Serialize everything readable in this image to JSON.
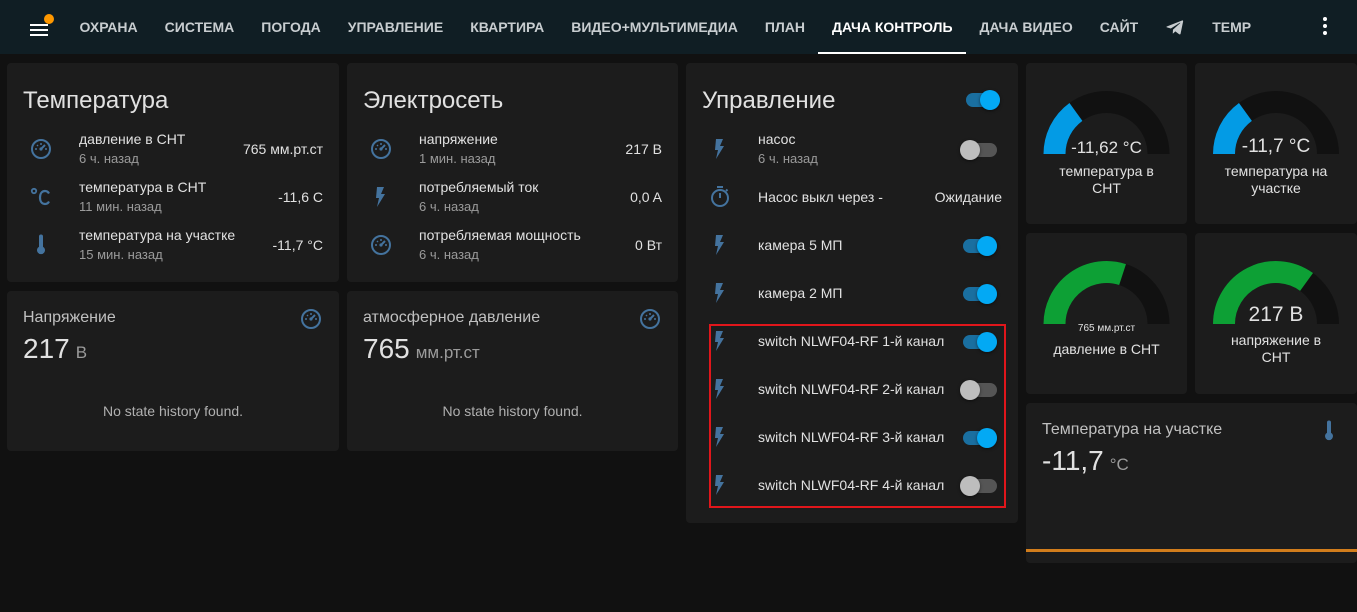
{
  "header": {
    "tabs": [
      {
        "label": "ОХРАНА"
      },
      {
        "label": "СИСТЕМА"
      },
      {
        "label": "ПОГОДА"
      },
      {
        "label": "УПРАВЛЕНИЕ"
      },
      {
        "label": "КВАРТИРА"
      },
      {
        "label": "ВИДЕО+МУЛЬТИМЕДИА"
      },
      {
        "label": "ПЛАН"
      },
      {
        "label": "ДАЧА КОНТРОЛЬ"
      },
      {
        "label": "ДАЧА ВИДЕО"
      },
      {
        "label": "САЙТ"
      },
      {
        "label": "",
        "icon": "telegram-icon"
      },
      {
        "label": "TEMP"
      }
    ],
    "active_tab": "ДАЧА КОНТРОЛЬ"
  },
  "temperature_card": {
    "title": "Температура",
    "rows": [
      {
        "name": "давление в СНТ",
        "sub": "6 ч. назад",
        "value": "765 мм.рт.ст",
        "icon": "gauge-icon"
      },
      {
        "name": "температура в СНТ",
        "sub": "11 мин. назад",
        "value": "-11,6 C",
        "icon": "celsius-icon"
      },
      {
        "name": "температура на участке",
        "sub": "15 мин. назад",
        "value": "-11,7 °C",
        "icon": "thermometer-icon"
      }
    ]
  },
  "power_card": {
    "title": "Электросеть",
    "rows": [
      {
        "name": "напряжение",
        "sub": "1 мин. назад",
        "value": "217 В",
        "icon": "gauge-icon"
      },
      {
        "name": "потребляемый ток",
        "sub": "6 ч. назад",
        "value": "0,0 A",
        "icon": "flash-icon"
      },
      {
        "name": "потребляемая мощность",
        "sub": "6 ч. назад",
        "value": "0 Вт",
        "icon": "gauge-icon"
      }
    ]
  },
  "control_card": {
    "title": "Управление",
    "master_toggle": true,
    "rows": [
      {
        "name": "насос",
        "sub": "6 ч. назад",
        "type": "toggle",
        "on": false,
        "icon": "flash-icon"
      },
      {
        "name": "Насос выкл через -",
        "type": "text",
        "value": "Ожидание",
        "icon": "timer-icon"
      },
      {
        "name": "камера 5 МП",
        "type": "toggle",
        "on": true,
        "icon": "flash-icon"
      },
      {
        "name": "камера 2 МП",
        "type": "toggle",
        "on": true,
        "icon": "flash-icon"
      },
      {
        "name": "switch NLWF04-RF 1-й канал",
        "type": "toggle",
        "on": true,
        "icon": "flash-icon"
      },
      {
        "name": "switch NLWF04-RF 2-й канал",
        "type": "toggle",
        "on": false,
        "icon": "flash-icon"
      },
      {
        "name": "switch NLWF04-RF 3-й канал",
        "type": "toggle",
        "on": true,
        "icon": "flash-icon"
      },
      {
        "name": "switch NLWF04-RF 4-й канал",
        "type": "toggle",
        "on": false,
        "icon": "flash-icon"
      }
    ]
  },
  "voltage_sensor": {
    "name": "Напряжение",
    "value": "217",
    "unit": "В",
    "history": "No state history found."
  },
  "pressure_sensor": {
    "name": "атмосферное давление",
    "value": "765",
    "unit": "мм.рт.ст",
    "history": "No state history found."
  },
  "gauges": [
    {
      "value": "-11,62 °C",
      "name_line1": "температура в",
      "name_line2": "СНТ",
      "level": 0.3,
      "color": "#039be5"
    },
    {
      "value": "-11,7 °C",
      "name_line1": "температура на",
      "name_line2": "участке",
      "level": 0.3,
      "color": "#039be5"
    },
    {
      "value": "765 мм.рт.ст",
      "name_line1": "давление в СНТ",
      "name_line2": "",
      "level": 0.6,
      "color": "#0da035"
    },
    {
      "value": "217 В",
      "name_line1": "напряжение в",
      "name_line2": "СНТ",
      "level": 0.7,
      "color": "#0da035"
    }
  ],
  "plot_sensor": {
    "name": "Температура на участке",
    "value": "-11,7",
    "unit": "°C",
    "line_color": "#d17d1c"
  },
  "colors": {
    "accent": "#03a9f4",
    "highlight": "#e0161b",
    "notification": "#ff9800"
  }
}
